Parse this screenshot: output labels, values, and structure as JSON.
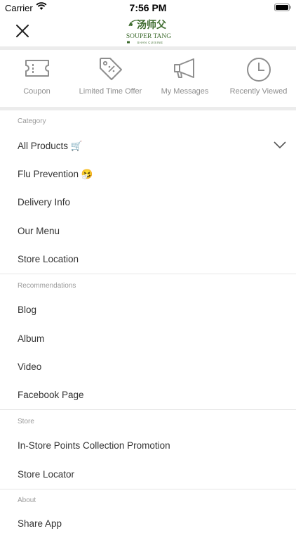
{
  "status_bar": {
    "carrier": "Carrier",
    "time": "7:56 PM"
  },
  "header": {
    "logo": {
      "chinese": "汤师父",
      "brand": "SOUPER TANG",
      "tagline": "SHAN CUISINE"
    }
  },
  "shortcuts": [
    {
      "label": "Coupon",
      "icon": "ticket-icon"
    },
    {
      "label": "Limited Time Offer",
      "icon": "price-tag-icon"
    },
    {
      "label": "My Messages",
      "icon": "megaphone-icon"
    },
    {
      "label": "Recently Viewed",
      "icon": "clock-icon"
    }
  ],
  "sections": {
    "category": {
      "title": "Category",
      "items": [
        "All Products 🛒",
        "Flu Prevention 🤧",
        "Delivery Info",
        "Our Menu",
        "Store Location"
      ]
    },
    "recommendations": {
      "title": "Recommendations",
      "items": [
        "Blog",
        "Album",
        "Video",
        "Facebook Page"
      ]
    },
    "store": {
      "title": "Store",
      "items": [
        "In-Store Points Collection Promotion",
        "Store Locator"
      ]
    },
    "about": {
      "title": "About",
      "items": [
        "Share App"
      ]
    }
  },
  "colors": {
    "logo_green": "#3d6b2e",
    "divider": "#ececec",
    "icon_gray": "#8e8e8e"
  }
}
